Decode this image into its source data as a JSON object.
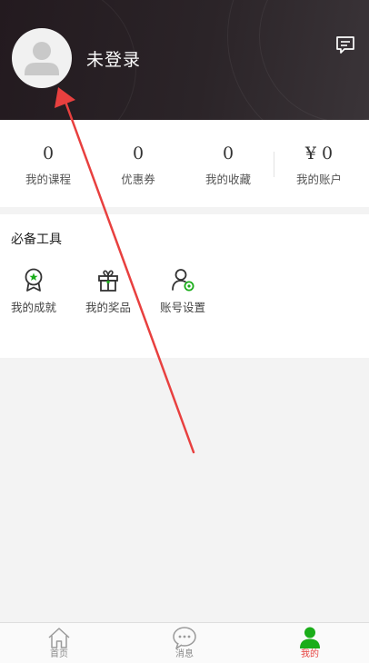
{
  "header": {
    "login_text": "未登录",
    "avatar_icon": "default-avatar-icon",
    "message_icon": "message-icon"
  },
  "stats": [
    {
      "value": "0",
      "label": "我的课程"
    },
    {
      "value": "0",
      "label": "优惠券"
    },
    {
      "value": "0",
      "label": "我的收藏"
    },
    {
      "value": "¥ 0",
      "label": "我的账户"
    }
  ],
  "tools": {
    "title": "必备工具",
    "items": [
      {
        "label": "我的成就",
        "icon": "medal-icon"
      },
      {
        "label": "我的奖品",
        "icon": "gift-icon"
      },
      {
        "label": "账号设置",
        "icon": "account-settings-icon"
      }
    ]
  },
  "tabbar": {
    "items": [
      {
        "label": "首页",
        "icon": "home-icon"
      },
      {
        "label": "消息",
        "icon": "chat-bubble-icon"
      },
      {
        "label": "我的",
        "icon": "user-icon",
        "active": true
      }
    ]
  },
  "colors": {
    "header_bg": "#2b2428",
    "accent_green": "#1aad19",
    "active_tab_label": "#e64340",
    "annotation_arrow": "#e8403f"
  }
}
